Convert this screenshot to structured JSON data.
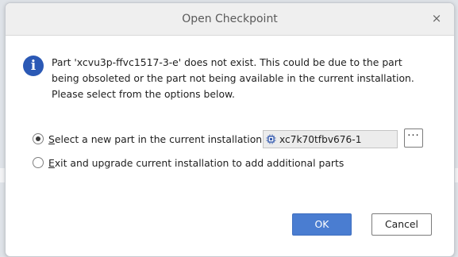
{
  "window": {
    "title": "Open Checkpoint",
    "close_glyph": "×"
  },
  "message": {
    "icon": "info-icon",
    "icon_glyph": "i",
    "icon_color": "#2b59b5",
    "text": "Part 'xcvu3p-ffvc1517-3-e' does not exist. This could be due to the part being obsoleted or the part not being available in the current installation. Please select from the options below."
  },
  "options": {
    "select_new_part": {
      "mnemonic": "S",
      "label_rest": "elect a new part in the current installation",
      "checked": true
    },
    "exit_upgrade": {
      "mnemonic": "E",
      "label_rest": "xit and upgrade current installation to add additional parts",
      "checked": false
    }
  },
  "part_selector": {
    "icon": "chip-icon",
    "value": "xc7k70tfbv676-1",
    "browse_label": "···"
  },
  "buttons": {
    "ok_label": "OK",
    "cancel_label": "Cancel",
    "ok_color": "#4a7dd1"
  }
}
